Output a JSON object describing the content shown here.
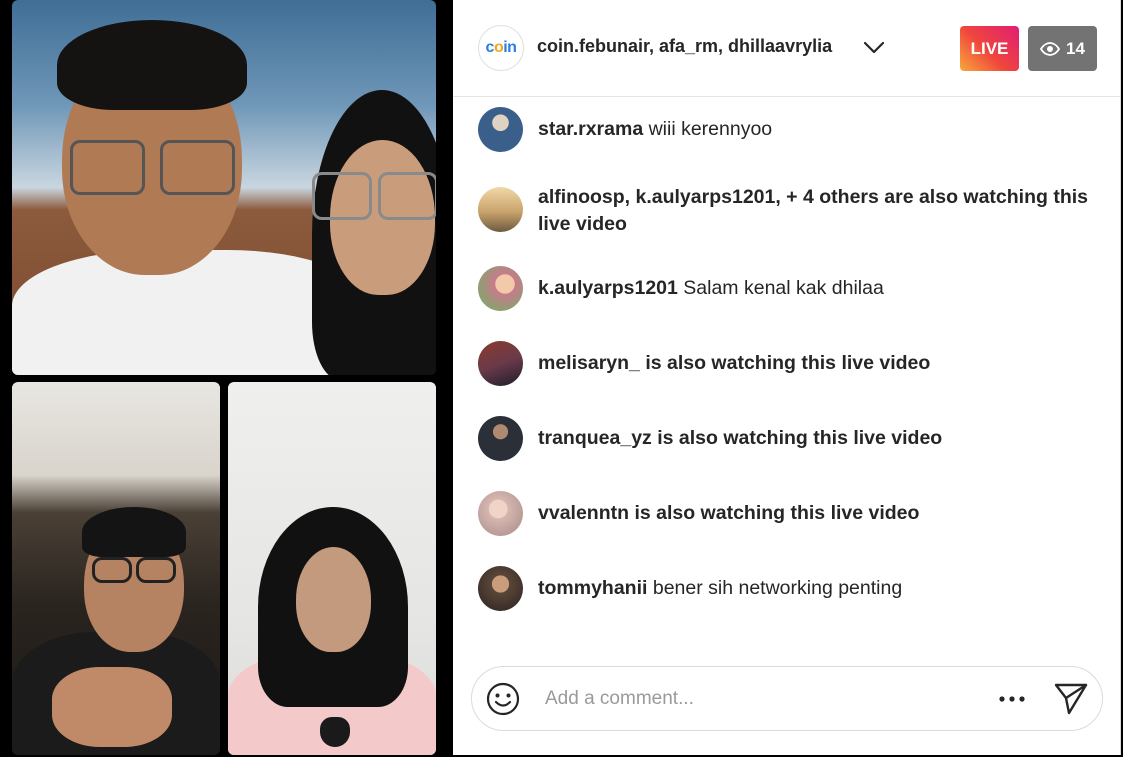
{
  "header": {
    "host_names": "coin.febunair, afa_rm, dhillaavrylia",
    "logo_text_1": "c",
    "logo_text_2": "o",
    "logo_text_3": "in",
    "live_label": "LIVE",
    "viewer_count": "14",
    "icons": {
      "dropdown": "chevron-down-icon",
      "viewers": "eye-icon"
    }
  },
  "comments": [
    {
      "user": "star.rxrama",
      "message": "wiii kerennyoo",
      "bold": false,
      "avatar_color": "#3a5f8a"
    },
    {
      "user": "",
      "message": "alfinoosp, k.aulyarps1201, + 4 others are also watching this live video",
      "bold": true,
      "avatar_color": "#c9a36b"
    },
    {
      "user": "k.aulyarps1201",
      "message": "Salam kenal kak dhilaa",
      "bold": false,
      "avatar_color": "#c97a8c"
    },
    {
      "user": "",
      "message": "melisaryn_ is also watching this live video",
      "bold": true,
      "avatar_color": "#6b3a4a"
    },
    {
      "user": "",
      "message": "tranquea_yz is also watching this live video",
      "bold": true,
      "avatar_color": "#2b2f38"
    },
    {
      "user": "",
      "message": "vvalenntn is also watching this live video",
      "bold": true,
      "avatar_color": "#d7b7b0"
    },
    {
      "user": "tommyhanii",
      "message": "bener sih networking penting",
      "bold": false,
      "avatar_color": "#5a4638"
    }
  ],
  "composer": {
    "placeholder": "Add a comment...",
    "icons": {
      "emoji": "emoji-icon",
      "more": "more-options-icon",
      "send": "send-icon"
    }
  },
  "colors": {
    "live_gradient": [
      "#f8a93b",
      "#f0463c",
      "#e11d74"
    ],
    "viewer_badge": "#737373",
    "text": "#262626"
  }
}
